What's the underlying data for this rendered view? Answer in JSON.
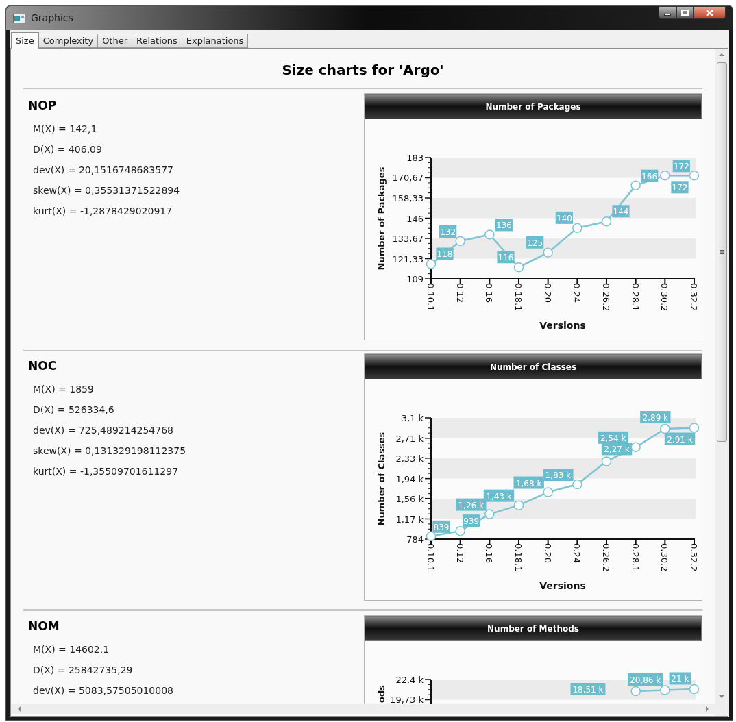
{
  "window": {
    "title": "Graphics"
  },
  "tabs": [
    {
      "label": "Size",
      "selected": true
    },
    {
      "label": "Complexity",
      "selected": false
    },
    {
      "label": "Other",
      "selected": false
    },
    {
      "label": "Relations",
      "selected": false
    },
    {
      "label": "Explanations",
      "selected": false
    }
  ],
  "page_title": "Size charts for 'Argo'",
  "sections": [
    {
      "name": "NOP",
      "stats": [
        "M(X) = 142,1",
        "D(X) = 406,09",
        "dev(X) = 20,1516748683577",
        "skew(X) = 0,35531371522894",
        "kurt(X) = -1,2878429020917"
      ],
      "chart_data": {
        "type": "line",
        "title": "Number of Packages",
        "xlabel": "Versions",
        "ylabel": "Number of Packages",
        "categories": [
          "0.10.1",
          "0.12",
          "0.16",
          "0.18.1",
          "0.20",
          "0.24",
          "0.26.2",
          "0.28.1",
          "0.30.2",
          "0.32.2"
        ],
        "ylim": [
          109,
          183
        ],
        "series": [
          {
            "color": "#7ec4d4",
            "marker": "circle",
            "values": [
              118,
              132,
              136,
              116,
              125,
              140,
              144,
              166,
              172,
              172
            ]
          }
        ],
        "yticks": [
          {
            "value": 183,
            "label": "183"
          },
          {
            "value": 170.67,
            "label": "170,67"
          },
          {
            "value": 158.33,
            "label": "158,33"
          },
          {
            "value": 146,
            "label": "146"
          },
          {
            "value": 133.67,
            "label": "133,67"
          },
          {
            "value": 121.33,
            "label": "121,33"
          },
          {
            "value": 109,
            "label": "109"
          }
        ],
        "value_labels": [
          "118",
          "132",
          "136",
          "116",
          "125",
          "140",
          "144",
          "166",
          "172",
          "172"
        ]
      }
    },
    {
      "name": "NOC",
      "stats": [
        "M(X) = 1859",
        "D(X) = 526334,6",
        "dev(X) = 725,489214254768",
        "skew(X) = 0,131329198112375",
        "kurt(X) = -1,35509701611297"
      ],
      "chart_data": {
        "type": "line",
        "title": "Number of Classes",
        "xlabel": "Versions",
        "ylabel": "Number of Classes",
        "categories": [
          "0.10.1",
          "0.12",
          "0.16",
          "0.18.1",
          "0.20",
          "0.24",
          "0.26.2",
          "0.28.1",
          "0.30.2",
          "0.32.2"
        ],
        "ylim": [
          784,
          3100
        ],
        "series": [
          {
            "color": "#7ec4d4",
            "marker": "circle",
            "values": [
              839,
              939,
              1260,
              1430,
              1680,
              1830,
              2270,
              2540,
              2890,
              2910
            ]
          }
        ],
        "yticks": [
          {
            "value": 3100,
            "label": "3,1 k"
          },
          {
            "value": 2710,
            "label": "2,71 k"
          },
          {
            "value": 2330,
            "label": "2,33 k"
          },
          {
            "value": 1940,
            "label": "1,94 k"
          },
          {
            "value": 1560,
            "label": "1,56 k"
          },
          {
            "value": 1170,
            "label": "1,17 k"
          },
          {
            "value": 784,
            "label": "784"
          }
        ],
        "value_labels": [
          "839",
          "939",
          "1,26 k",
          "1,43 k",
          "1,68 k",
          "1,83 k",
          "2,27 k",
          "2,54 k",
          "2,89 k",
          "2,91 k"
        ]
      }
    },
    {
      "name": "NOM",
      "stats": [
        "M(X) = 14602,1",
        "D(X) = 25842735,29",
        "dev(X) = 5083,57505010008"
      ],
      "chart_data": {
        "type": "line",
        "title": "Number of Methods",
        "ylabel": "ods",
        "ylim": [
          19140,
          22400
        ],
        "series": [
          {
            "color": "#7ec4d4",
            "marker": "circle",
            "values": [
              null,
              null,
              null,
              null,
              null,
              null,
              null,
              20860,
              21000,
              21130
            ]
          }
        ],
        "yticks": [
          {
            "value": 22400,
            "label": "22,4 k"
          },
          {
            "value": 19730,
            "label": "19,73 k"
          }
        ],
        "value_labels": [
          null,
          null,
          null,
          null,
          null,
          null,
          "18,51 k",
          "20,86 k",
          "21 k",
          null
        ]
      }
    }
  ]
}
